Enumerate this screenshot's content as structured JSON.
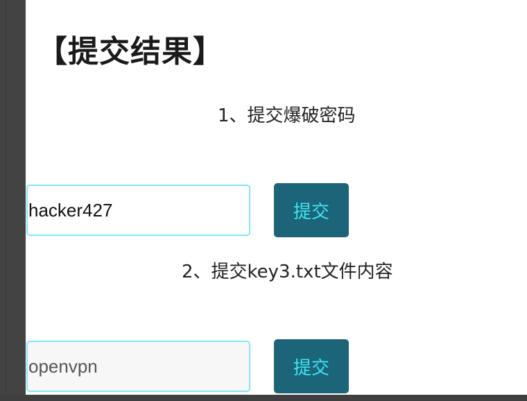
{
  "page": {
    "title": "【提交结果】"
  },
  "sections": [
    {
      "label": "1、提交爆破密码",
      "input_value": "hacker427",
      "input_placeholder": "",
      "button_label": "提交"
    },
    {
      "label": "2、提交key3.txt文件内容",
      "input_value": "",
      "input_placeholder": "openvpn",
      "button_label": "提交"
    }
  ],
  "colors": {
    "button_bg": "#1c6478",
    "button_text": "#3be7f2",
    "input_border": "#7fe7f7"
  }
}
